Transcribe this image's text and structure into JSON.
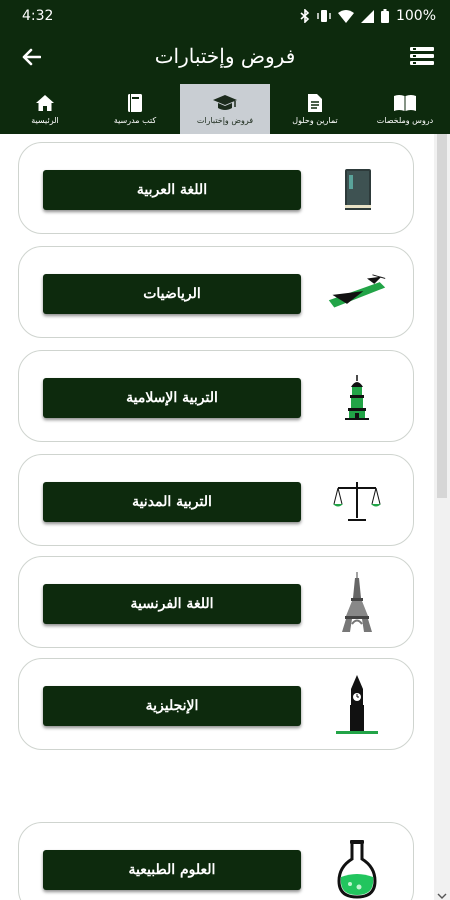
{
  "status_bar": {
    "time": "4:32",
    "battery": "100%"
  },
  "header": {
    "title": "فروض وإختبارات",
    "back_icon": "arrow-left-icon",
    "menu_icon": "list-menu-icon"
  },
  "tabs": [
    {
      "label": "الرئيسية",
      "icon": "home-icon",
      "active": false
    },
    {
      "label": "كتب مدرسية",
      "icon": "book-icon",
      "active": false
    },
    {
      "label": "فروض وإختبارات",
      "icon": "graduation-cap-icon",
      "active": true
    },
    {
      "label": "تمارين وحلول",
      "icon": "document-icon",
      "active": false
    },
    {
      "label": "دروس وملخصات",
      "icon": "open-book-icon",
      "active": false
    }
  ],
  "subjects": [
    {
      "label": "اللغة العربية",
      "icon": "quran-book-icon"
    },
    {
      "label": "الرياضيات",
      "icon": "set-square-icon"
    },
    {
      "label": "التربية الإسلامية",
      "icon": "mosque-minaret-icon"
    },
    {
      "label": "التربية المدنية",
      "icon": "balance-scale-icon"
    },
    {
      "label": "اللغة الفرنسية",
      "icon": "eiffel-tower-icon"
    },
    {
      "label": "الإنجليزية",
      "icon": "big-ben-icon"
    },
    {
      "label": "العلوم الطبيعية",
      "icon": "flask-icon"
    }
  ],
  "colors": {
    "primary": "#0d2a0d",
    "accent": "#22a447",
    "active_tab": "#c9ced3"
  }
}
